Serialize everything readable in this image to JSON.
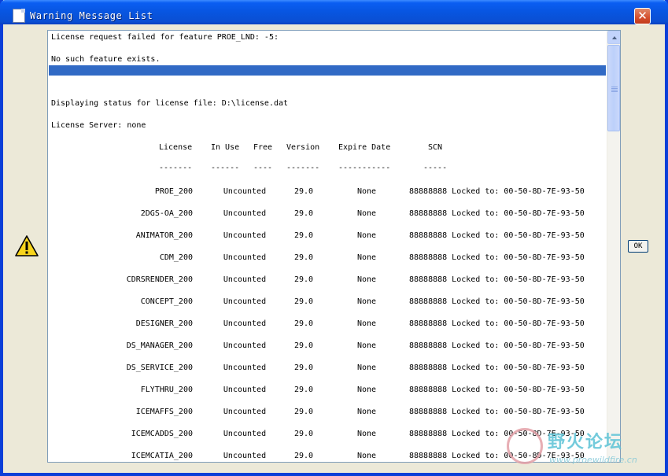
{
  "window": {
    "title": "Warning Message List",
    "close_label": "✕"
  },
  "messages": {
    "line1": "License request failed for feature PROE_LND: -5:",
    "line2": "No such feature exists.",
    "line3": "Displaying status for license file: D:\\license.dat",
    "line4": "License Server: none"
  },
  "table": {
    "headers": [
      "License",
      "In Use",
      "Free",
      "Version",
      "Expire Date",
      "SCN"
    ],
    "dividers": [
      "-------",
      "------",
      "----",
      "-------",
      "-----------",
      "-----"
    ],
    "rows": [
      {
        "license": "PROE_200",
        "in_use": "Uncounted",
        "version": "29.0",
        "expire": "None",
        "scn": "88888888 Locked to: 00-50-8D-7E-93-50"
      },
      {
        "license": "2DGS-OA_200",
        "in_use": "Uncounted",
        "version": "29.0",
        "expire": "None",
        "scn": "88888888 Locked to: 00-50-8D-7E-93-50"
      },
      {
        "license": "ANIMATOR_200",
        "in_use": "Uncounted",
        "version": "29.0",
        "expire": "None",
        "scn": "88888888 Locked to: 00-50-8D-7E-93-50"
      },
      {
        "license": "CDM_200",
        "in_use": "Uncounted",
        "version": "29.0",
        "expire": "None",
        "scn": "88888888 Locked to: 00-50-8D-7E-93-50"
      },
      {
        "license": "CDRSRENDER_200",
        "in_use": "Uncounted",
        "version": "29.0",
        "expire": "None",
        "scn": "88888888 Locked to: 00-50-8D-7E-93-50"
      },
      {
        "license": "CONCEPT_200",
        "in_use": "Uncounted",
        "version": "29.0",
        "expire": "None",
        "scn": "88888888 Locked to: 00-50-8D-7E-93-50"
      },
      {
        "license": "DESIGNER_200",
        "in_use": "Uncounted",
        "version": "29.0",
        "expire": "None",
        "scn": "88888888 Locked to: 00-50-8D-7E-93-50"
      },
      {
        "license": "DS_MANAGER_200",
        "in_use": "Uncounted",
        "version": "29.0",
        "expire": "None",
        "scn": "88888888 Locked to: 00-50-8D-7E-93-50"
      },
      {
        "license": "DS_SERVICE_200",
        "in_use": "Uncounted",
        "version": "29.0",
        "expire": "None",
        "scn": "88888888 Locked to: 00-50-8D-7E-93-50"
      },
      {
        "license": "FLYTHRU_200",
        "in_use": "Uncounted",
        "version": "29.0",
        "expire": "None",
        "scn": "88888888 Locked to: 00-50-8D-7E-93-50"
      },
      {
        "license": "ICEMAFFS_200",
        "in_use": "Uncounted",
        "version": "29.0",
        "expire": "None",
        "scn": "88888888 Locked to: 00-50-8D-7E-93-50"
      },
      {
        "license": "ICEMCADDS_200",
        "in_use": "Uncounted",
        "version": "29.0",
        "expire": "None",
        "scn": "88888888 Locked to: 00-50-8D-7E-93-50"
      },
      {
        "license": "ICEMCATIA_200",
        "in_use": "Uncounted",
        "version": "29.0",
        "expire": "None",
        "scn": "88888888 Locked to: 00-50-8D-7E-93-50"
      }
    ]
  },
  "ok_label": "OK",
  "watermark": {
    "text": "野火论坛",
    "url": "www.proewildfire.cn"
  },
  "icons": {
    "warning": "warning-triangle-icon",
    "title": "document-icon"
  }
}
